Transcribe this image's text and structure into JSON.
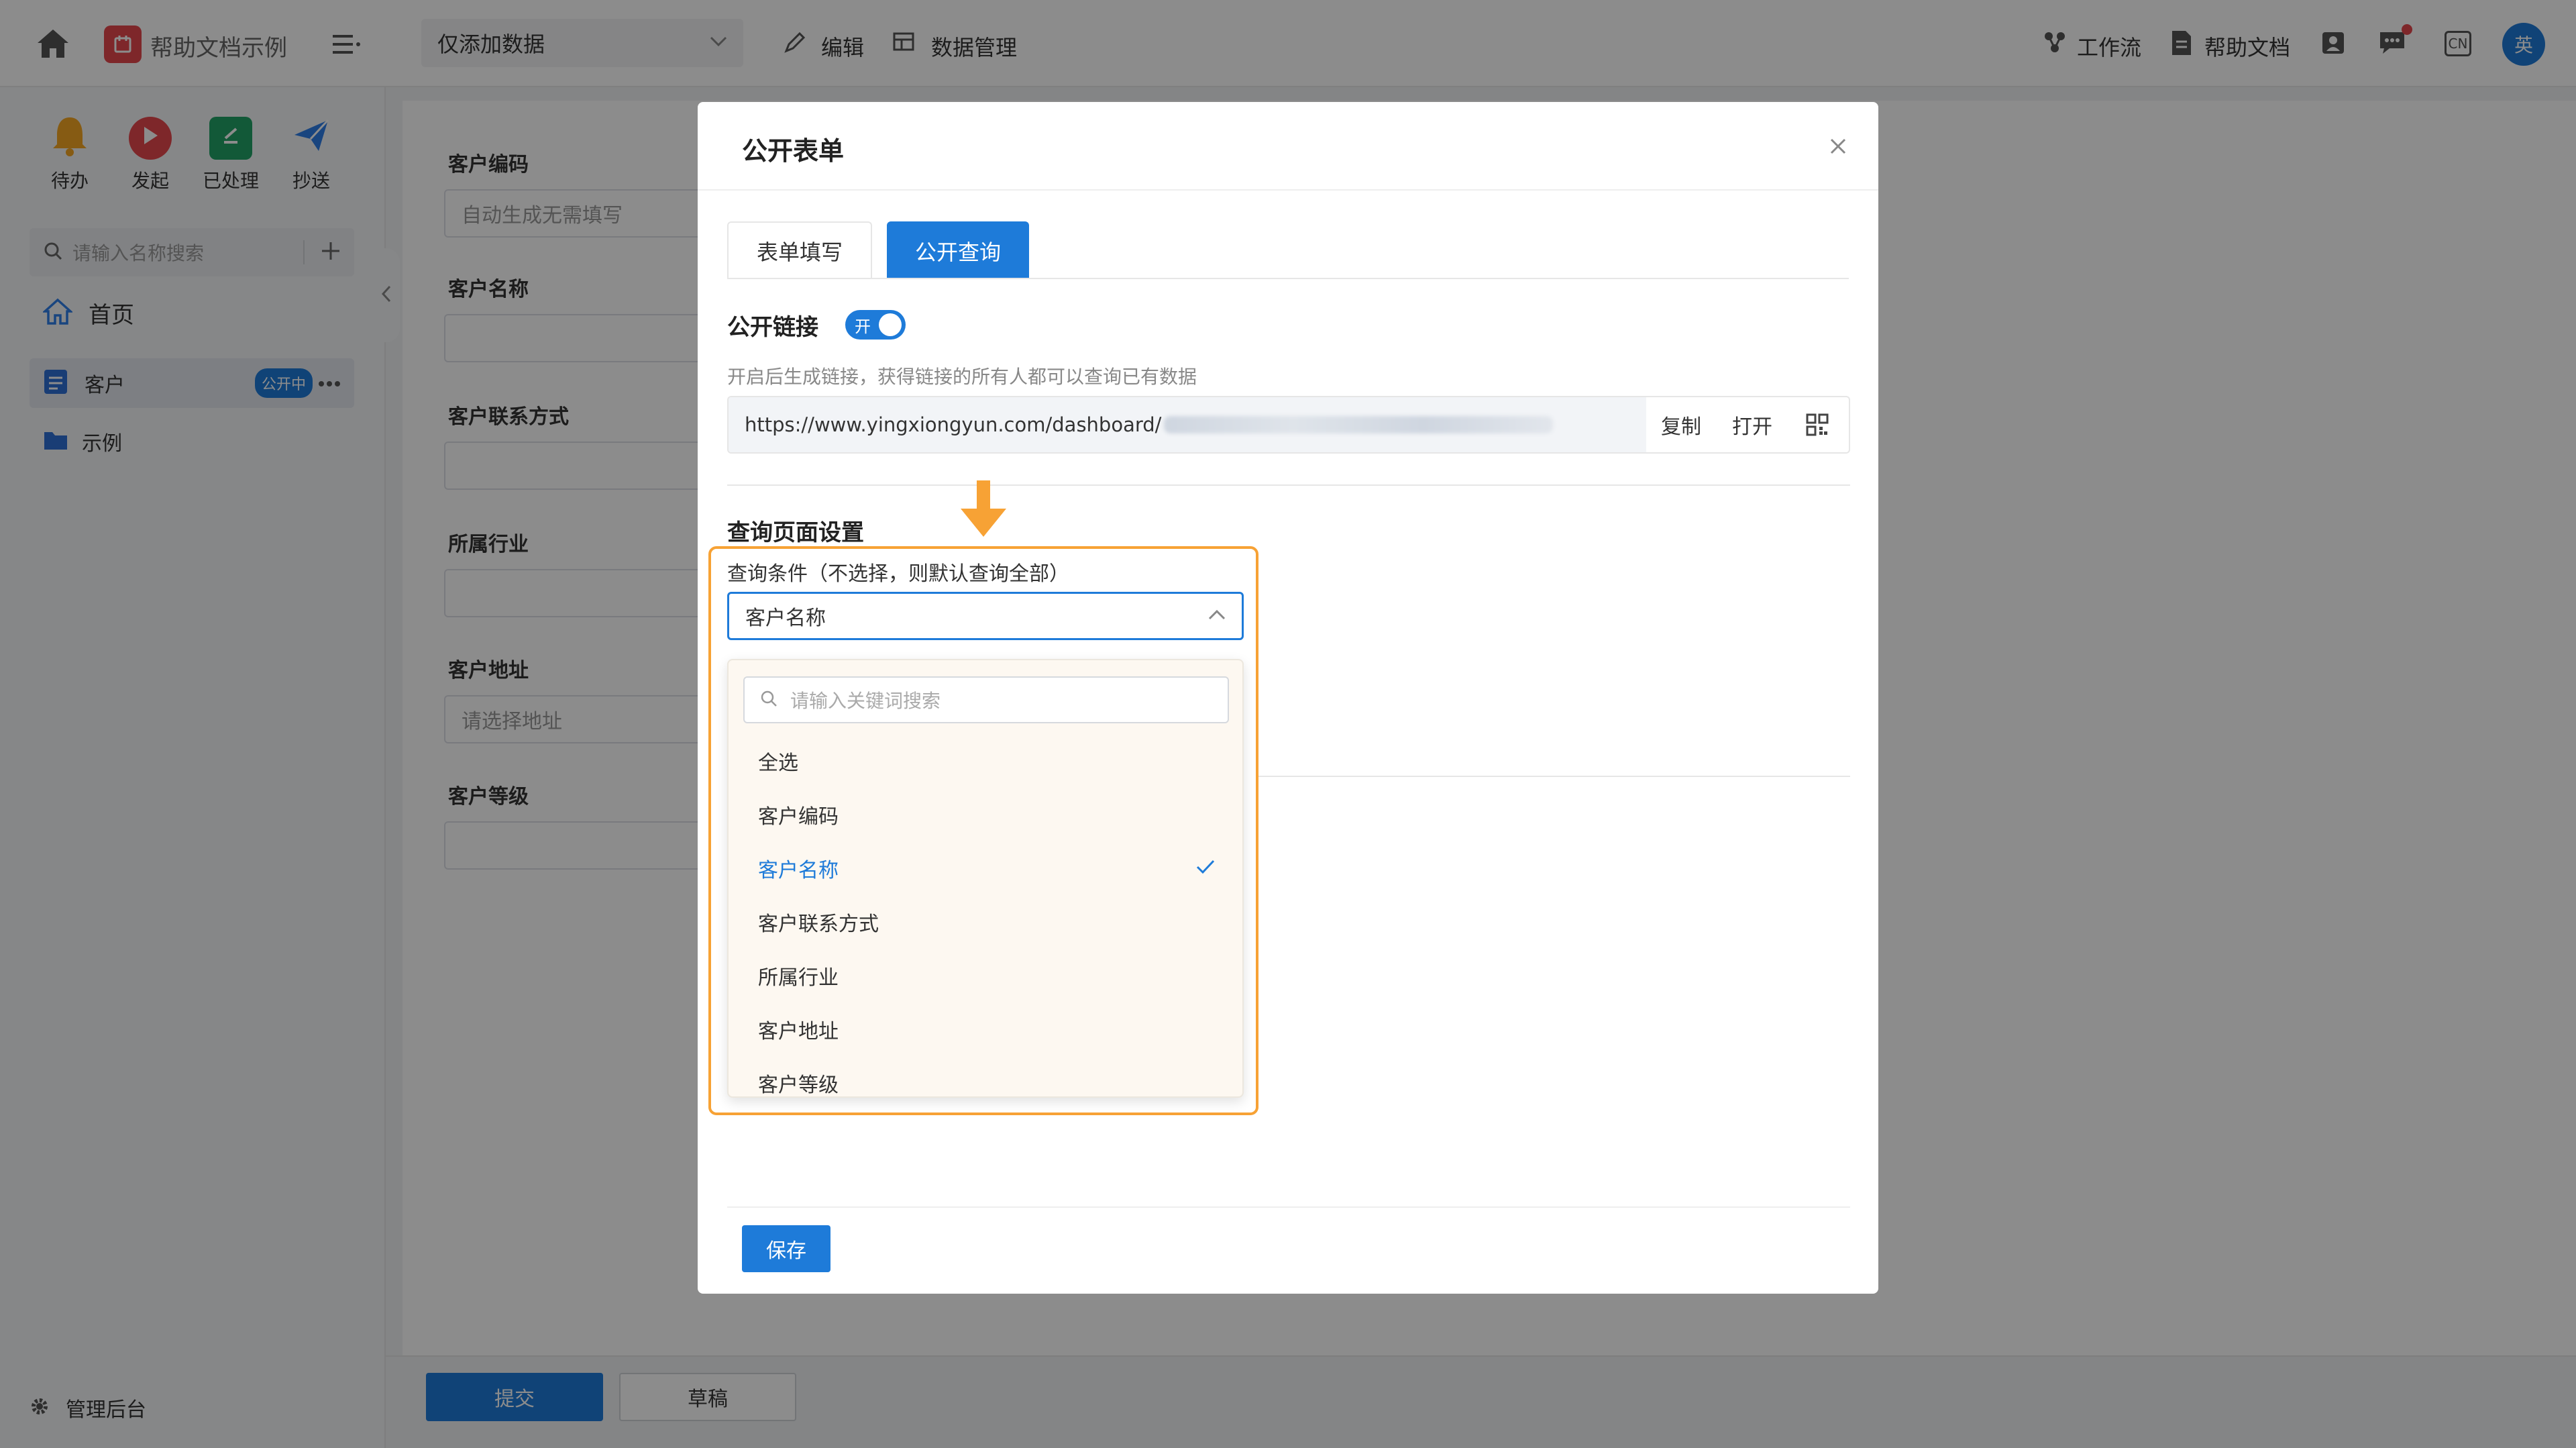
{
  "topbar": {
    "app_name": "帮助文档示例",
    "view_select": "仅添加数据",
    "edit": "编辑",
    "data_manage": "数据管理",
    "workflow": "工作流",
    "help_doc": "帮助文档",
    "lang_badge": "CN",
    "avatar": "英"
  },
  "sidebar": {
    "quick_actions": [
      {
        "label": "待办",
        "icon": "bell-icon",
        "color": "#f5a623"
      },
      {
        "label": "发起",
        "icon": "play-icon",
        "color": "#e5484d"
      },
      {
        "label": "已处理",
        "icon": "check-doc-icon",
        "color": "#21a366"
      },
      {
        "label": "抄送",
        "icon": "send-icon",
        "color": "#2f7ee8"
      }
    ],
    "search_placeholder": "请输入名称搜索",
    "home": "首页",
    "items": [
      {
        "label": "客户",
        "badge": "公开中"
      },
      {
        "label": "示例"
      }
    ],
    "admin": "管理后台"
  },
  "form": {
    "fields": [
      {
        "label": "客户编码",
        "value": "自动生成无需填写"
      },
      {
        "label": "客户名称",
        "value": ""
      },
      {
        "label": "客户联系方式",
        "value": ""
      },
      {
        "label": "所属行业",
        "value": ""
      },
      {
        "label": "客户地址",
        "value": "请选择地址"
      },
      {
        "label": "客户等级",
        "value": ""
      }
    ],
    "submit": "提交",
    "draft": "草稿"
  },
  "modal": {
    "title": "公开表单",
    "tabs": [
      {
        "label": "表单填写",
        "active": false
      },
      {
        "label": "公开查询",
        "active": true
      }
    ],
    "public_link_label": "公开链接",
    "switch_label": "开",
    "hint": "开启后生成链接，获得链接的所有人都可以查询已有数据",
    "url": "https://www.yingxiongyun.com/dashboard/",
    "copy": "复制",
    "open": "打开",
    "query_settings_title": "查询页面设置",
    "query_condition_label": "查询条件（不选择，则默认查询全部）",
    "selected_value": "客户名称",
    "dropdown": {
      "search_placeholder": "请输入关键词搜索",
      "options": [
        {
          "label": "全选",
          "selected": false
        },
        {
          "label": "客户编码",
          "selected": false
        },
        {
          "label": "客户名称",
          "selected": true
        },
        {
          "label": "客户联系方式",
          "selected": false
        },
        {
          "label": "所属行业",
          "selected": false
        },
        {
          "label": "客户地址",
          "selected": false
        },
        {
          "label": "客户等级",
          "selected": false
        }
      ]
    },
    "save": "保存"
  },
  "colors": {
    "primary": "#1e7bd9",
    "highlight": "#f7a235",
    "selected_text": "#1e7bd9"
  }
}
